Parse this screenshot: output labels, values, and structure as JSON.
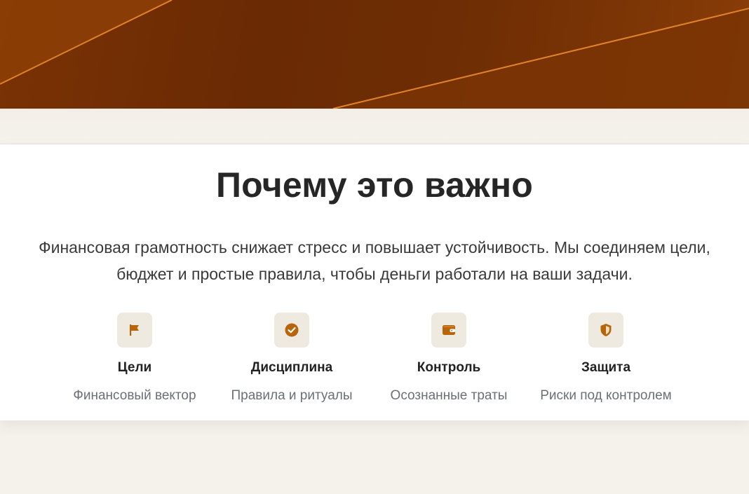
{
  "section": {
    "title": "Почему это важно",
    "lead_line1": "Финансовая грамотность снижает стресс и повышает устойчивость. Мы соединяем цели,",
    "lead_line2": "бюджет и простые правила, чтобы деньги работали на ваши задачи."
  },
  "features": [
    {
      "icon": "flag-icon",
      "title": "Цели",
      "subtitle": "Финансовый вектор"
    },
    {
      "icon": "check-circle-icon",
      "title": "Дисциплина",
      "subtitle": "Правила и ритуалы"
    },
    {
      "icon": "wallet-icon",
      "title": "Контроль",
      "subtitle": "Осознанные траты"
    },
    {
      "icon": "shield-icon",
      "title": "Защита",
      "subtitle": "Риски под контролем"
    }
  ],
  "colors": {
    "accent": "#b8650a",
    "hero_dark": "#6a2a04",
    "hero_line": "#e0822a",
    "icon_bg": "#efeae0",
    "page_bg": "#f5f2ec"
  }
}
